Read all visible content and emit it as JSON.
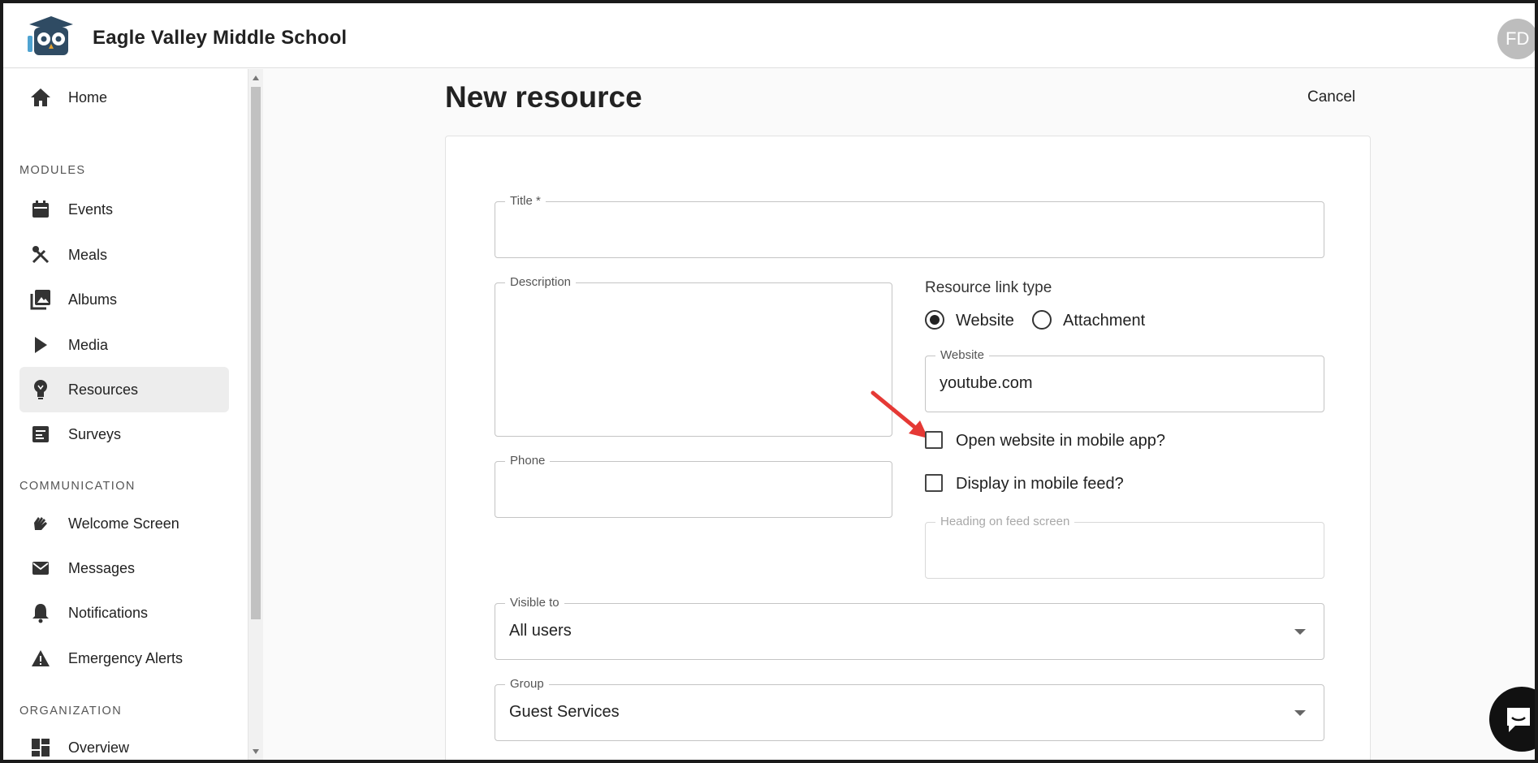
{
  "header": {
    "school_name": "Eagle Valley Middle School",
    "avatar_initials": "FD"
  },
  "sidebar": {
    "home": "Home",
    "sections": {
      "modules": "MODULES",
      "communication": "COMMUNICATION",
      "organization": "ORGANIZATION"
    },
    "modules": [
      {
        "label": "Events",
        "icon": "calendar-icon"
      },
      {
        "label": "Meals",
        "icon": "utensils-icon"
      },
      {
        "label": "Albums",
        "icon": "photos-icon"
      },
      {
        "label": "Media",
        "icon": "play-icon"
      },
      {
        "label": "Resources",
        "icon": "lightbulb-icon",
        "active": true
      },
      {
        "label": "Surveys",
        "icon": "survey-icon"
      }
    ],
    "communication": [
      {
        "label": "Welcome Screen",
        "icon": "waving-hand-icon"
      },
      {
        "label": "Messages",
        "icon": "mail-icon"
      },
      {
        "label": "Notifications",
        "icon": "bell-icon"
      },
      {
        "label": "Emergency Alerts",
        "icon": "warning-icon"
      }
    ],
    "organization": [
      {
        "label": "Overview",
        "icon": "dashboard-icon"
      }
    ]
  },
  "page": {
    "title": "New resource",
    "cancel_label": "Cancel"
  },
  "form": {
    "title_label": "Title *",
    "title_value": "",
    "description_label": "Description",
    "phone_label": "Phone",
    "link_type_label": "Resource link type",
    "link_types": [
      {
        "label": "Website",
        "selected": true
      },
      {
        "label": "Attachment",
        "selected": false
      }
    ],
    "website_label": "Website",
    "website_value": "youtube.com",
    "open_in_app_label": "Open website in mobile app?",
    "open_in_app_checked": false,
    "display_in_feed_label": "Display in mobile feed?",
    "display_in_feed_checked": false,
    "feed_heading_label": "Heading on feed screen",
    "visible_to_label": "Visible to",
    "visible_to_value": "All users",
    "group_label": "Group",
    "group_value": "Guest Services"
  },
  "colors": {
    "annotation_arrow": "#e53935",
    "accent": "#222222",
    "active_bg": "#ededed"
  }
}
